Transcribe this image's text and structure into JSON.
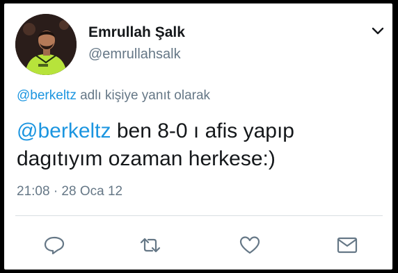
{
  "tweet": {
    "author": {
      "display_name": "Emrullah Şalk",
      "handle": "@emrullahsalk"
    },
    "reply_context": {
      "mention": "@berkeltz",
      "text": " adlı kişiye yanıt olarak"
    },
    "body": {
      "mention": "@berkeltz",
      "text": " ben 8-0 ı afis yapıp dagıtıyım ozaman herkese:)"
    },
    "timestamp": "21:08 · 28 Oca 12"
  },
  "icons": {
    "menu": "chevron-down-icon",
    "reply": "reply-icon",
    "retweet": "retweet-icon",
    "like": "heart-icon",
    "message": "envelope-icon"
  },
  "colors": {
    "mention": "#1b95e0",
    "muted": "#657786",
    "text": "#14171a",
    "icon": "#657786"
  }
}
